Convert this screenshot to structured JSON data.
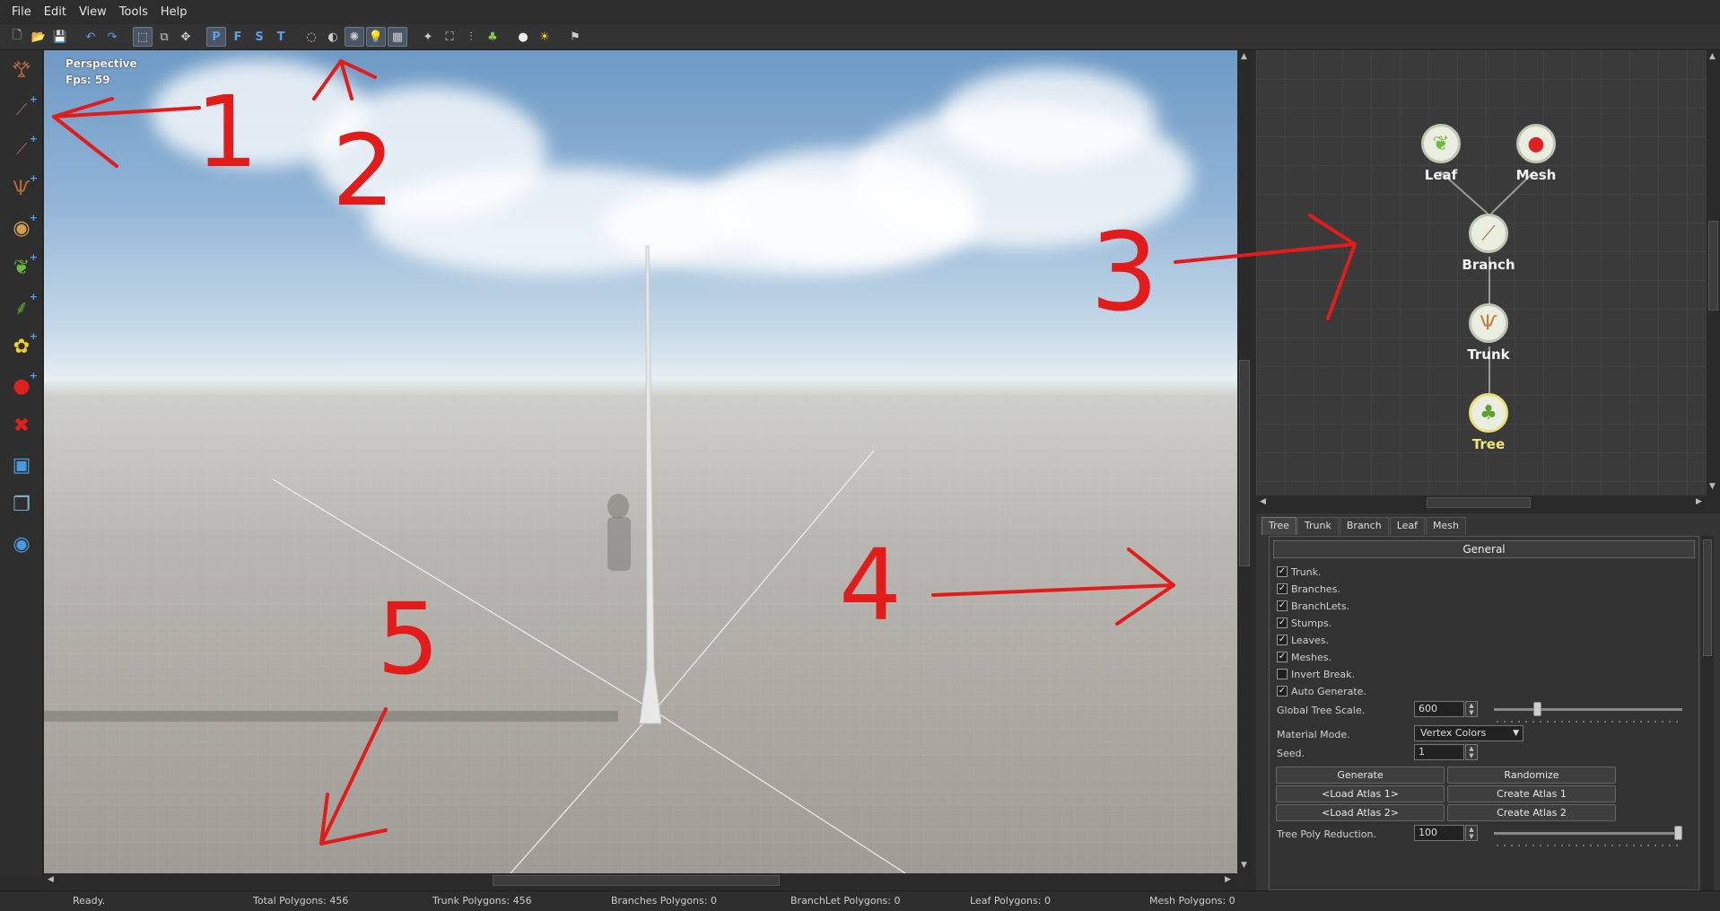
{
  "menu": [
    "File",
    "Edit",
    "View",
    "Tools",
    "Help"
  ],
  "toolbar": {
    "letters": [
      "P",
      "F",
      "S",
      "T"
    ]
  },
  "viewport": {
    "mode": "Perspective",
    "fps": "Fps: 59"
  },
  "graph": {
    "nodes": [
      {
        "label": "Leaf",
        "icon": "leaf-icon"
      },
      {
        "label": "Mesh",
        "icon": "apple-icon"
      },
      {
        "label": "Branch",
        "icon": "branch-icon"
      },
      {
        "label": "Trunk",
        "icon": "trunk-icon"
      },
      {
        "label": "Tree",
        "icon": "tree-icon"
      }
    ]
  },
  "props": {
    "tabs": [
      "Tree",
      "Trunk",
      "Branch",
      "Leaf",
      "Mesh"
    ],
    "section": "General",
    "checkboxes": [
      {
        "label": "Trunk.",
        "checked": true
      },
      {
        "label": "Branches.",
        "checked": true
      },
      {
        "label": "BranchLets.",
        "checked": true
      },
      {
        "label": "Stumps.",
        "checked": true
      },
      {
        "label": "Leaves.",
        "checked": true
      },
      {
        "label": "Meshes.",
        "checked": true
      },
      {
        "label": "Invert Break.",
        "checked": false
      },
      {
        "label": "Auto Generate.",
        "checked": true
      }
    ],
    "global_scale_label": "Global Tree Scale.",
    "global_scale_value": "600",
    "global_scale_slider": 0.22,
    "material_label": "Material Mode.",
    "material_value": "Vertex Colors",
    "seed_label": "Seed.",
    "seed_value": "1",
    "buttons": {
      "generate": "Generate",
      "randomize": "Randomize",
      "load_atlas_1": "<Load Atlas 1>",
      "create_atlas_1": "Create Atlas 1",
      "load_atlas_2": "<Load Atlas 2>",
      "create_atlas_2": "Create Atlas 2"
    },
    "poly_reduction_label": "Tree Poly Reduction.",
    "poly_reduction_value": "100",
    "poly_reduction_slider": 1.0
  },
  "status": {
    "ready": "Ready.",
    "total": "Total Polygons: 456",
    "trunk": "Trunk Polygons: 456",
    "branches": "Branches Polygons: 0",
    "branchlet": "BranchLet Polygons: 0",
    "leaf": "Leaf Polygons: 0",
    "mesh": "Mesh Polygons: 0"
  },
  "annotations": [
    "1",
    "2",
    "3",
    "4",
    "5"
  ],
  "colors": {
    "annotation": "#e21b1b",
    "accent": "#5aa0e6"
  }
}
